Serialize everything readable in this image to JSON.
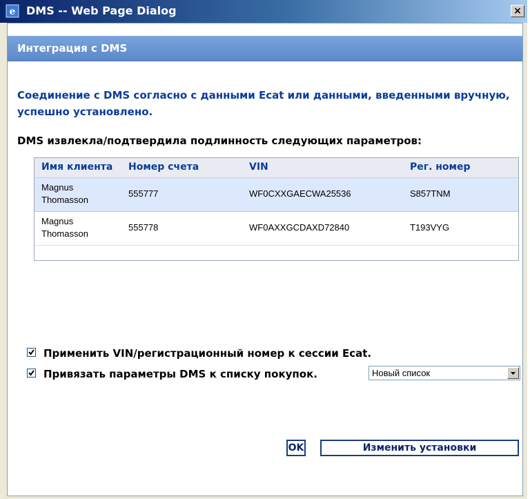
{
  "window": {
    "title": "DMS -- Web Page Dialog",
    "close_glyph": "×",
    "app_icon": "ie-icon"
  },
  "header": {
    "title": "Интеграция с DMS"
  },
  "status_message": "Соединение с DMS согласно с данными Ecat или данными, введенными вручную, успешно установлено.",
  "params_heading": "DMS извлекла/подтвердила подлинность следующих параметров:",
  "table": {
    "columns": [
      "Имя клиента",
      "Номер счета",
      "VIN",
      "Рег. номер"
    ],
    "rows": [
      {
        "name_first": "Magnus",
        "name_last": "Thomasson",
        "account": "555777",
        "vin": "WF0CXXGAECWA25536",
        "reg": "S857TNM",
        "selected": true
      },
      {
        "name_first": "Magnus",
        "name_last": "Thomasson",
        "account": "555778",
        "vin": "WF0AXXGCDAXD72840",
        "reg": "T193VYG",
        "selected": false
      }
    ]
  },
  "options": {
    "apply_vin": {
      "label": "Применить VIN/регистрационный номер к сессии Ecat.",
      "checked": true
    },
    "link_dms": {
      "label": "Привязать параметры DMS к списку покупок.",
      "checked": true,
      "select_value": "Новый список"
    }
  },
  "buttons": {
    "ok": "OK",
    "change": "Изменить установки"
  },
  "colors": {
    "accent": "#0a3c9a",
    "header": "#5a88c8",
    "selected_row": "#dce8fb"
  }
}
